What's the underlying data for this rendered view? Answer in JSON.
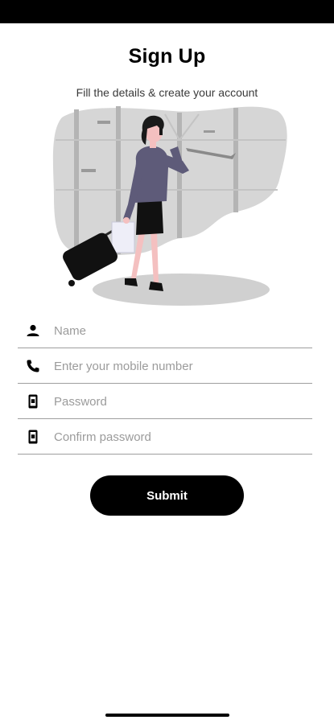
{
  "header": {
    "title": "Sign Up",
    "subtitle": "Fill the details & create your account"
  },
  "form": {
    "fields": [
      {
        "placeholder": "Name",
        "value": "",
        "icon": "person-icon"
      },
      {
        "placeholder": "Enter your mobile number",
        "value": "",
        "icon": "phone-icon"
      },
      {
        "placeholder": "Password",
        "value": "",
        "icon": "mobile-device-icon"
      },
      {
        "placeholder": "Confirm password",
        "value": "",
        "icon": "mobile-device-icon"
      }
    ],
    "submit_label": "Submit"
  },
  "colors": {
    "accent": "#000000",
    "illustration_bg": "#d6d6d6",
    "jacket": "#5e5b79",
    "skin": "#f4c0c0"
  }
}
